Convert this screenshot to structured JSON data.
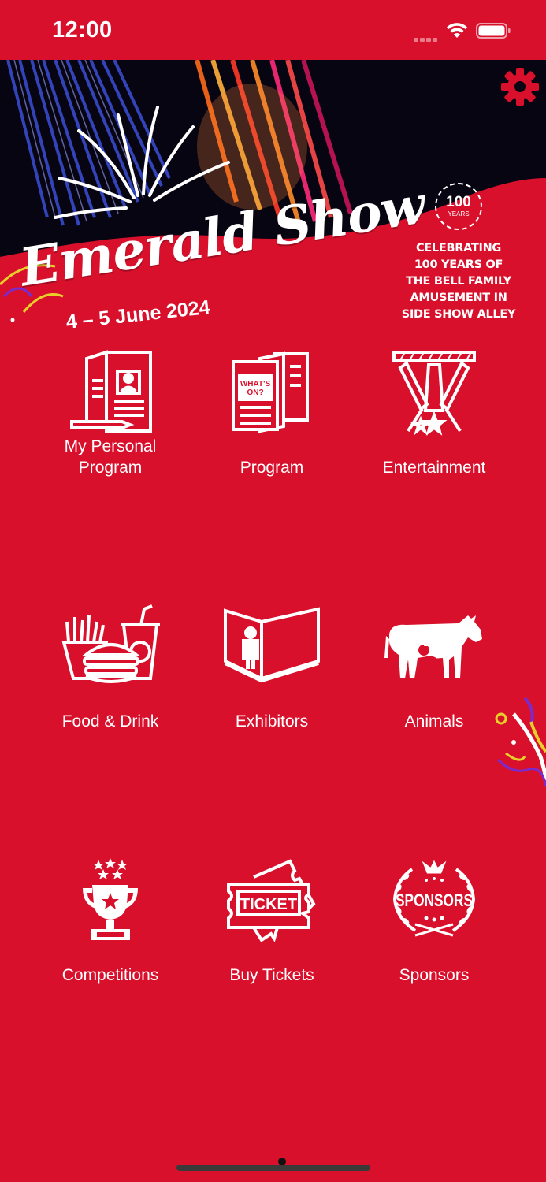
{
  "status_bar": {
    "time": "12:00"
  },
  "banner": {
    "logo_text": "Emerald Show",
    "dates": "4 – 5 June 2024",
    "badge_number": "100",
    "badge_label": "YEARS",
    "celebrating_lines": [
      "CELEBRATING",
      "100 YEARS OF",
      "THE BELL FAMILY",
      "AMUSEMENT IN",
      "SIDE SHOW ALLEY"
    ]
  },
  "menu": {
    "items": [
      {
        "label_line1": "My Personal",
        "label_line2": "Program",
        "icon": "personal-program-icon"
      },
      {
        "label": "Program",
        "icon": "program-icon",
        "icon_text_1": "WHAT'S",
        "icon_text_2": "ON?"
      },
      {
        "label": "Entertainment",
        "icon": "stage-lights-icon"
      },
      {
        "label": "Food & Drink",
        "icon": "food-drink-icon"
      },
      {
        "label": "Exhibitors",
        "icon": "exhibitor-booth-icon"
      },
      {
        "label": "Animals",
        "icon": "farm-animals-icon"
      },
      {
        "label": "Competitions",
        "icon": "trophy-icon"
      },
      {
        "label": "Buy Tickets",
        "icon": "ticket-icon",
        "icon_text": "TICKET"
      },
      {
        "label": "Sponsors",
        "icon": "sponsors-icon",
        "icon_text": "SPONSORS"
      }
    ]
  },
  "colors": {
    "background": "#d8102c",
    "text": "#ffffff"
  }
}
